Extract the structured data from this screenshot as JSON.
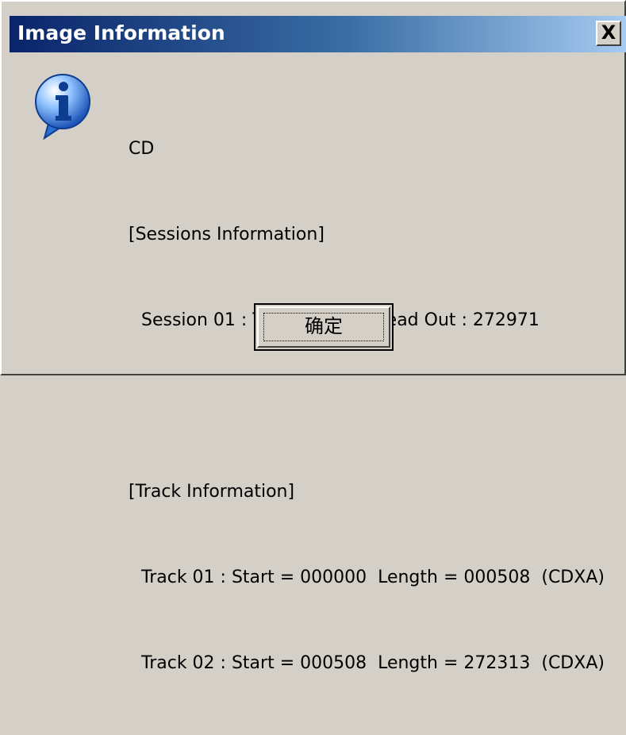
{
  "window": {
    "title": "Image Information",
    "close_label": "X"
  },
  "icon": {
    "name": "info-icon",
    "glyph": "i",
    "color": "#2a6fd6"
  },
  "message": {
    "lines": [
      "CD",
      "[Sessions Information]",
      "Session 01 : Track 01 - 02  Lead Out : 272971",
      "",
      "[Track Information]",
      "Track 01 : Start = 000000  Length = 000508  (CDXA)",
      "Track 02 : Start = 000508  Length = 272313  (CDXA)"
    ]
  },
  "buttons": {
    "ok_label": "确定"
  }
}
